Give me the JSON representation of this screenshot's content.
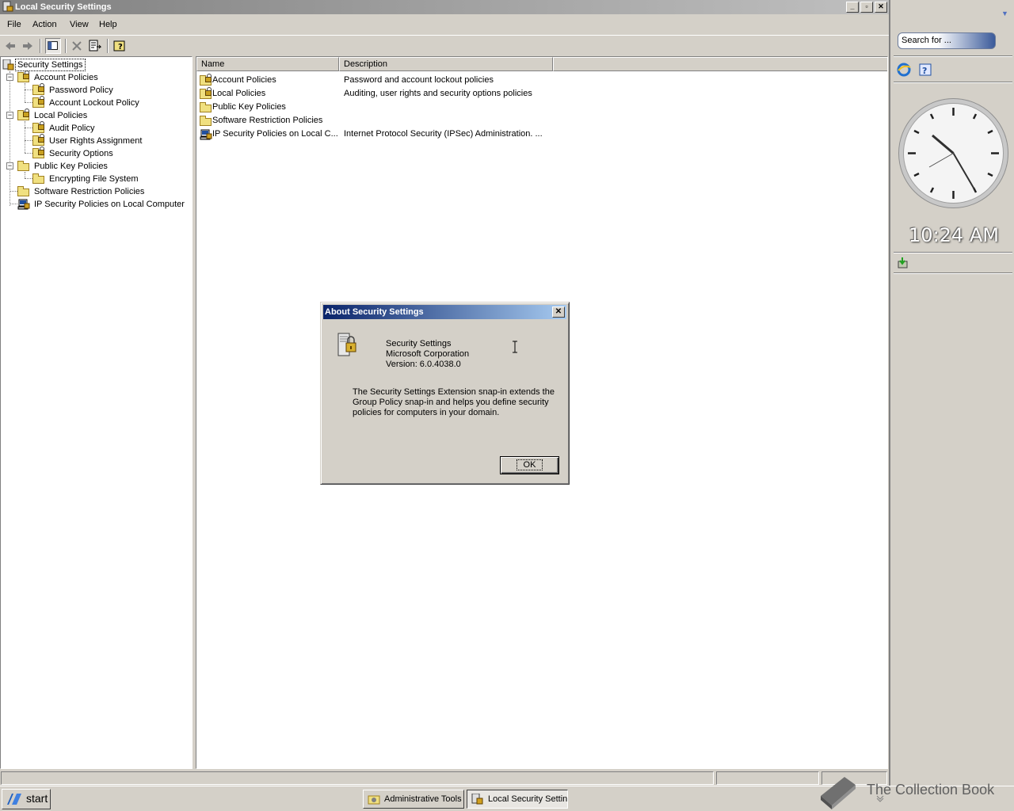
{
  "window": {
    "title": "Local Security Settings"
  },
  "menubar": {
    "items": [
      "File",
      "Action",
      "View",
      "Help"
    ]
  },
  "tree": {
    "root": "Security Settings",
    "nodes": [
      {
        "label": "Account Policies",
        "level": 1,
        "expander": "−"
      },
      {
        "label": "Password Policy",
        "level": 2
      },
      {
        "label": "Account Lockout Policy",
        "level": 2
      },
      {
        "label": "Local Policies",
        "level": 1,
        "expander": "−"
      },
      {
        "label": "Audit Policy",
        "level": 2
      },
      {
        "label": "User Rights Assignment",
        "level": 2
      },
      {
        "label": "Security Options",
        "level": 2
      },
      {
        "label": "Public Key Policies",
        "level": 1,
        "expander": "−"
      },
      {
        "label": "Encrypting File System",
        "level": 2
      },
      {
        "label": "Software Restriction Policies",
        "level": 1
      },
      {
        "label": "IP Security Policies on Local Computer",
        "level": 1
      }
    ]
  },
  "list": {
    "columns": [
      "Name",
      "Description"
    ],
    "rows": [
      {
        "name": "Account Policies",
        "description": "Password and account lockout policies",
        "icon": "locked-folder-icon"
      },
      {
        "name": "Local Policies",
        "description": "Auditing, user rights and security options policies",
        "icon": "locked-folder-icon"
      },
      {
        "name": "Public Key Policies",
        "description": "",
        "icon": "folder-icon"
      },
      {
        "name": "Software Restriction Policies",
        "description": "",
        "icon": "folder-icon"
      },
      {
        "name": "IP Security Policies on Local C...",
        "description": "Internet Protocol Security (IPSec) Administration. ...",
        "icon": "ipsec-icon"
      }
    ]
  },
  "dialog": {
    "title": "About Security Settings",
    "product": "Security Settings",
    "company": "Microsoft Corporation",
    "version": "Version: 6.0.4038.0",
    "description": "The Security Settings Extension snap-in extends the Group Policy snap-in and helps you define security policies for computers in your domain.",
    "ok_label": "OK"
  },
  "taskbar": {
    "start_label": "start",
    "buttons": [
      {
        "label": "Administrative Tools",
        "active": false
      },
      {
        "label": "Local Security Settings",
        "active": true
      }
    ]
  },
  "sidebar": {
    "search_placeholder": "Search for ...",
    "clock_time": "10:24 AM"
  },
  "watermark": {
    "text": "The Collection Book"
  },
  "colors": {
    "dialog_title": "#0a246a",
    "window_title_inactive": "#808080",
    "face": "#d4d0c8"
  }
}
